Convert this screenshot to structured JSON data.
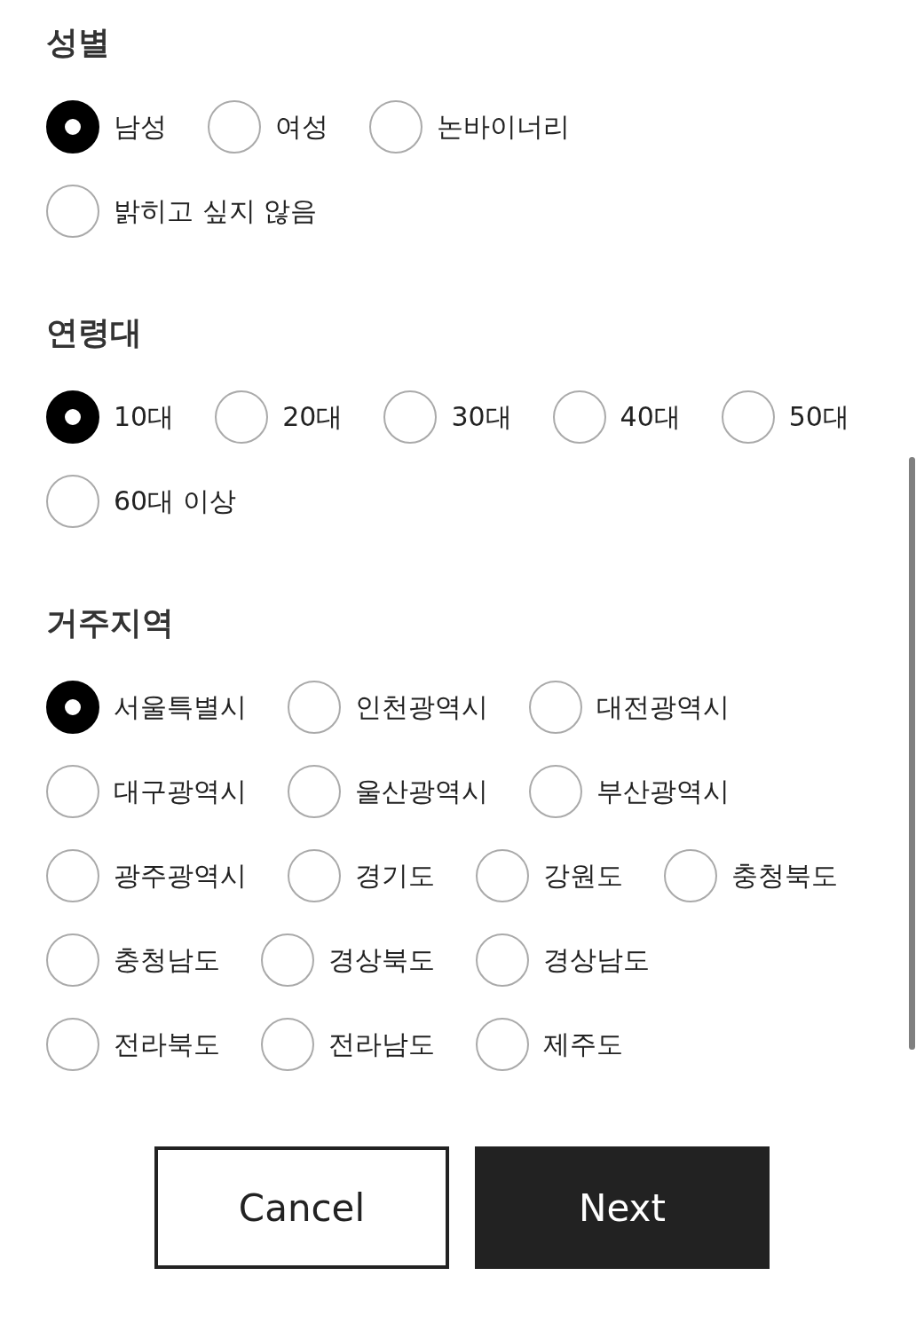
{
  "sections": [
    {
      "title": "성별",
      "options": [
        {
          "label": "남성",
          "selected": true
        },
        {
          "label": "여성",
          "selected": false
        },
        {
          "label": "논바이너리",
          "selected": false
        },
        {
          "label": "밝히고 싶지 않음",
          "selected": false
        }
      ]
    },
    {
      "title": "연령대",
      "options": [
        {
          "label": "10대",
          "selected": true
        },
        {
          "label": "20대",
          "selected": false
        },
        {
          "label": "30대",
          "selected": false
        },
        {
          "label": "40대",
          "selected": false
        },
        {
          "label": "50대",
          "selected": false
        },
        {
          "label": "60대 이상",
          "selected": false
        }
      ]
    },
    {
      "title": "거주지역",
      "options": [
        {
          "label": "서울특별시",
          "selected": true
        },
        {
          "label": "인천광역시",
          "selected": false
        },
        {
          "label": "대전광역시",
          "selected": false
        },
        {
          "label": "대구광역시",
          "selected": false
        },
        {
          "label": "울산광역시",
          "selected": false
        },
        {
          "label": "부산광역시",
          "selected": false
        },
        {
          "label": "광주광역시",
          "selected": false
        },
        {
          "label": "경기도",
          "selected": false
        },
        {
          "label": "강원도",
          "selected": false
        },
        {
          "label": "충청북도",
          "selected": false
        },
        {
          "label": "충청남도",
          "selected": false
        },
        {
          "label": "경상북도",
          "selected": false
        },
        {
          "label": "경상남도",
          "selected": false
        },
        {
          "label": "전라북도",
          "selected": false
        },
        {
          "label": "전라남도",
          "selected": false
        },
        {
          "label": "제주도",
          "selected": false
        }
      ]
    }
  ],
  "buttons": [
    {
      "label": "Cancel",
      "kind": "secondary"
    },
    {
      "label": "Next",
      "kind": "primary"
    }
  ]
}
